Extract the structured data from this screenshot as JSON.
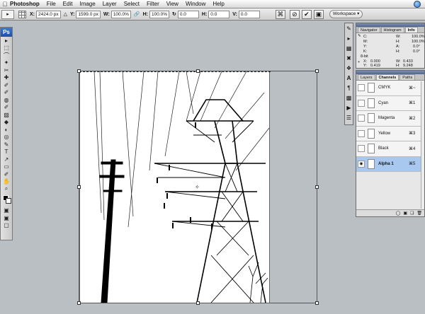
{
  "menubar": {
    "apple": "",
    "app": "Photoshop",
    "items": [
      "File",
      "Edit",
      "Image",
      "Layer",
      "Select",
      "Filter",
      "View",
      "Window",
      "Help"
    ]
  },
  "options": {
    "x_label": "X:",
    "x_value": "2424.0 px",
    "y_label": "Y:",
    "y_value": "1599.0 px",
    "w_label": "W:",
    "w_value": "100.0%",
    "h_label": "H:",
    "h_value": "100.0%",
    "rot_value": "0.0",
    "hskew_label": "H:",
    "hskew_value": "0.0",
    "vskew_label": "V:",
    "vskew_value": "0.0",
    "workspace": "Workspace ▾"
  },
  "tools": {
    "ps_logo": "Ps",
    "glyphs": [
      "▸",
      "⬚",
      "⌒",
      "✦",
      "✂",
      "✚",
      "✐",
      "✐",
      "◍",
      "✐",
      "▨",
      "◆",
      "◐",
      "◎",
      "✎",
      "T",
      "↗",
      "▭",
      "✐",
      "✋",
      "⌕",
      "▣",
      "▣",
      "▢"
    ]
  },
  "info_panel": {
    "tabs": [
      "Navigator",
      "Histogram",
      "Info"
    ],
    "c_label": "C:",
    "m_label": "M:",
    "y_label": "Y:",
    "k_label": "K:",
    "bit_label": "8-bit",
    "w_label": "W:",
    "w_val": "100.0%",
    "h_label": "H:",
    "h_val": "100.0%",
    "a_label": "A:",
    "a_val": "0.0°",
    "hs_label": "H:",
    "hs_val": "0.0°",
    "x_label": "X:",
    "x_val": "0.000",
    "y2_label": "Y:",
    "y2_val": "0.419",
    "w2_label": "W:",
    "w2_val": "0.433",
    "h2_label": "H:",
    "h2_val": "9.248"
  },
  "channels_panel": {
    "tabs": [
      "Layers",
      "Channels",
      "Paths"
    ],
    "rows": [
      {
        "name": "CMYK",
        "shortcut": "⌘~"
      },
      {
        "name": "Cyan",
        "shortcut": "⌘1"
      },
      {
        "name": "Magenta",
        "shortcut": "⌘2"
      },
      {
        "name": "Yellow",
        "shortcut": "⌘3"
      },
      {
        "name": "Black",
        "shortcut": "⌘4"
      },
      {
        "name": "Alpha 1",
        "shortcut": "⌘5"
      }
    ]
  },
  "colors": {
    "accent": "#3b7ad8",
    "selected_row": "#a9c8ef"
  }
}
